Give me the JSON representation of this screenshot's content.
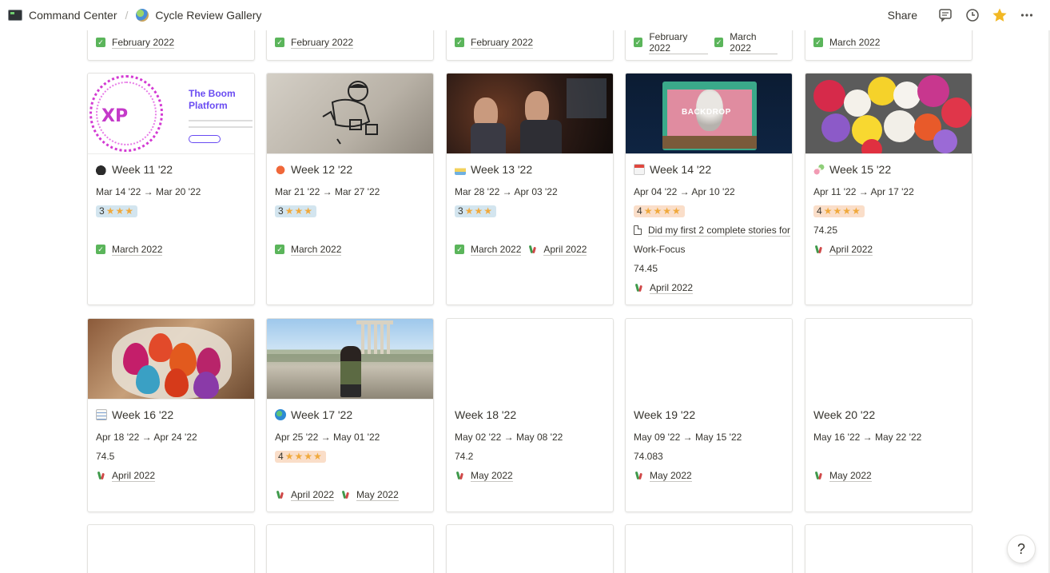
{
  "breadcrumb": {
    "workspace": "Command Center",
    "separator": "/",
    "page": "Cycle Review Gallery"
  },
  "toolbar": {
    "share_label": "Share",
    "icons": [
      "comments-icon",
      "history-icon",
      "favorite-star-icon",
      "more-icon"
    ]
  },
  "top_row_tags": [
    [
      {
        "icon": "check",
        "label": "February 2022"
      }
    ],
    [
      {
        "icon": "check",
        "label": "February 2022"
      }
    ],
    [
      {
        "icon": "check",
        "label": "February 2022"
      }
    ],
    [
      {
        "icon": "check",
        "label": "February 2022"
      },
      {
        "icon": "check",
        "label": "March 2022"
      }
    ],
    [
      {
        "icon": "check",
        "label": "March 2022"
      }
    ]
  ],
  "cards": [
    {
      "title": "Week 11 '22",
      "title_icon": "bomb-icon",
      "cover": "xp",
      "dates": "Mar 14 '22 → Mar 20 '22",
      "rating": 3,
      "rating_text": "3",
      "stars": "★★★",
      "tags": [
        {
          "icon": "check",
          "label": "March 2022"
        }
      ]
    },
    {
      "title": "Week 12 '22",
      "title_icon": "crab-icon",
      "cover": "bag",
      "dates": "Mar 21 '22 → Mar 27 '22",
      "rating": 3,
      "rating_text": "3",
      "stars": "★★★",
      "tags": [
        {
          "icon": "check",
          "label": "March 2022"
        }
      ]
    },
    {
      "title": "Week 13 '22",
      "title_icon": "cake-icon",
      "cover": "bar",
      "dates": "Mar 28 '22 → Apr 03 '22",
      "rating": 3,
      "rating_text": "3",
      "stars": "★★★",
      "tags": [
        {
          "icon": "check",
          "label": "March 2022"
        },
        {
          "icon": "cactus",
          "label": "April 2022"
        }
      ]
    },
    {
      "title": "Week 14 '22",
      "title_icon": "calendar-icon",
      "cover": "backdrop",
      "cover_text": "BACKDROP",
      "dates": "Apr 04 '22 → Apr 10 '22",
      "rating": 4,
      "rating_text": "4",
      "stars": "★★★★",
      "page_link": "Did my first 2 complete stories for",
      "extra": "Work-Focus",
      "score": "74.45",
      "tags": [
        {
          "icon": "cactus",
          "label": "April 2022"
        }
      ]
    },
    {
      "title": "Week 15 '22",
      "title_icon": "dango-icon",
      "cover": "flowers",
      "dates": "Apr 11 '22 → Apr 17 '22",
      "rating": 4,
      "rating_text": "4",
      "stars": "★★★★",
      "score": "74.25",
      "tags": [
        {
          "icon": "cactus",
          "label": "April 2022"
        }
      ]
    },
    {
      "title": "Week 16 '22",
      "title_icon": "notepad-icon",
      "cover": "eggs",
      "dates": "Apr 18 '22 → Apr 24 '22",
      "score": "74.5",
      "tags": [
        {
          "icon": "cactus",
          "label": "April 2022"
        }
      ]
    },
    {
      "title": "Week 17 '22",
      "title_icon": "earth-icon",
      "cover": "ruins",
      "dates": "Apr 25 '22 → May 01 '22",
      "rating": 4,
      "rating_text": "4",
      "stars": "★★★★",
      "tags": [
        {
          "icon": "cactus",
          "label": "April 2022"
        },
        {
          "icon": "cactus",
          "label": "May 2022"
        }
      ]
    },
    {
      "title": "Week 18 '22",
      "dates": "May 02 '22 → May 08 '22",
      "score": "74.2",
      "tags": [
        {
          "icon": "cactus",
          "label": "May 2022"
        }
      ]
    },
    {
      "title": "Week 19 '22",
      "dates": "May 09 '22 → May 15 '22",
      "score": "74.083",
      "tags": [
        {
          "icon": "cactus",
          "label": "May 2022"
        }
      ]
    },
    {
      "title": "Week 20 '22",
      "dates": "May 16 '22 → May 22 '22",
      "tags": [
        {
          "icon": "cactus",
          "label": "May 2022"
        }
      ]
    }
  ],
  "help_label": "?",
  "colors": {
    "rating3_bg": "#d3e5ef",
    "rating4_bg": "#fadec9",
    "star": "#f0a93c",
    "check": "#5bb55b",
    "favorite": "#f2b824"
  }
}
